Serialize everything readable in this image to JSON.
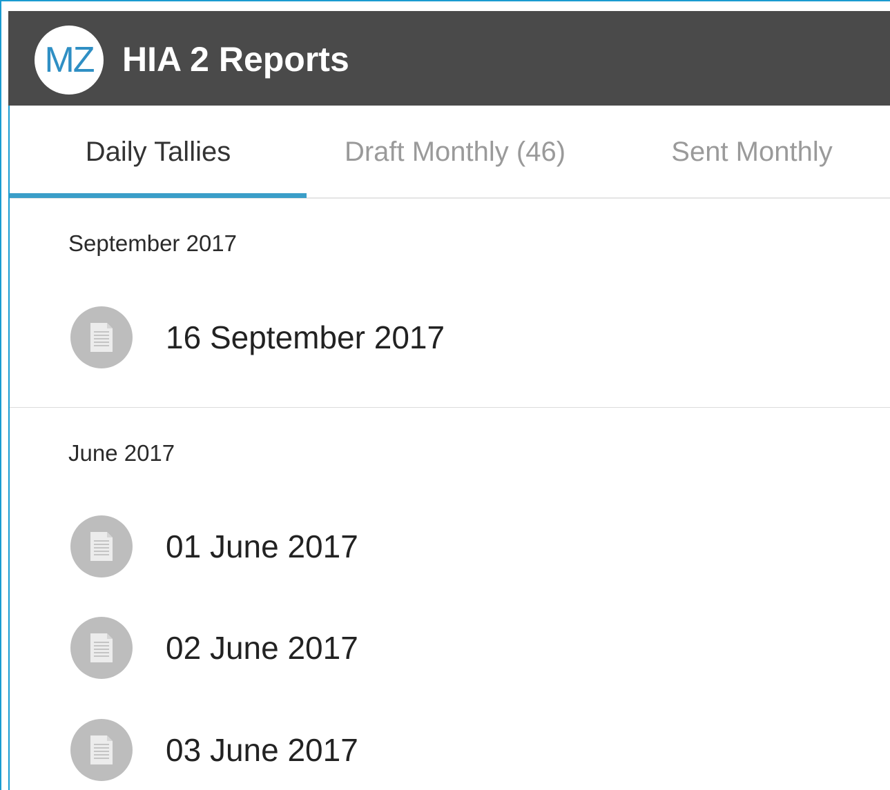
{
  "app": {
    "logo_text": "MZ",
    "title": "HIA 2 Reports"
  },
  "tabs": [
    {
      "label": "Daily Tallies",
      "active": true
    },
    {
      "label": "Draft Monthly (46)",
      "active": false
    },
    {
      "label": "Sent Monthly",
      "active": false
    }
  ],
  "sections": [
    {
      "header": "September 2017",
      "items": [
        {
          "label": "16 September 2017",
          "icon": "document-icon"
        }
      ]
    },
    {
      "header": "June 2017",
      "items": [
        {
          "label": "01 June 2017",
          "icon": "document-icon"
        },
        {
          "label": "02 June 2017",
          "icon": "document-icon"
        },
        {
          "label": "03 June 2017",
          "icon": "document-icon"
        }
      ]
    }
  ],
  "colors": {
    "appbar": "#4a4a4a",
    "accent": "#3a9ec8",
    "logo_text": "#2f8fc4",
    "icon_circle": "#bdbdbd"
  }
}
